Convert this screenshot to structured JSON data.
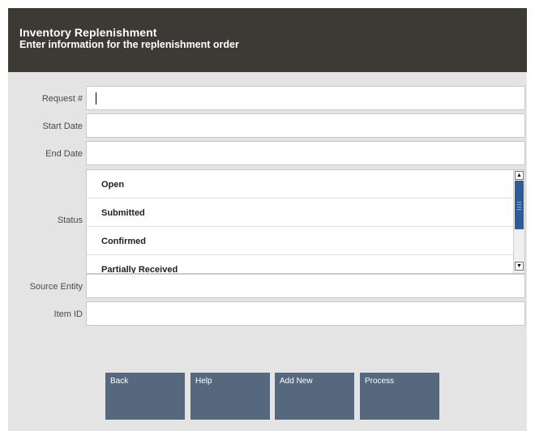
{
  "header": {
    "title": "Inventory Replenishment",
    "subtitle": "Enter information for the replenishment order"
  },
  "form": {
    "request": {
      "label": "Request #",
      "value": ""
    },
    "start_date": {
      "label": "Start Date",
      "value": ""
    },
    "end_date": {
      "label": "End Date",
      "value": ""
    },
    "status": {
      "label": "Status",
      "options": [
        "Open",
        "Submitted",
        "Confirmed",
        "Partially Received"
      ]
    },
    "source_entity": {
      "label": "Source Entity",
      "value": ""
    },
    "item_id": {
      "label": "Item ID",
      "value": ""
    }
  },
  "buttons": {
    "back": "Back",
    "help": "Help",
    "add_new": "Add New",
    "process": "Process"
  },
  "colors": {
    "header_bg": "#3d3935",
    "button_bg": "#56687e",
    "scroll_thumb": "#2f5b96"
  },
  "icons": {
    "scroll_up": "arrow-up-icon",
    "scroll_down": "arrow-down-icon"
  }
}
